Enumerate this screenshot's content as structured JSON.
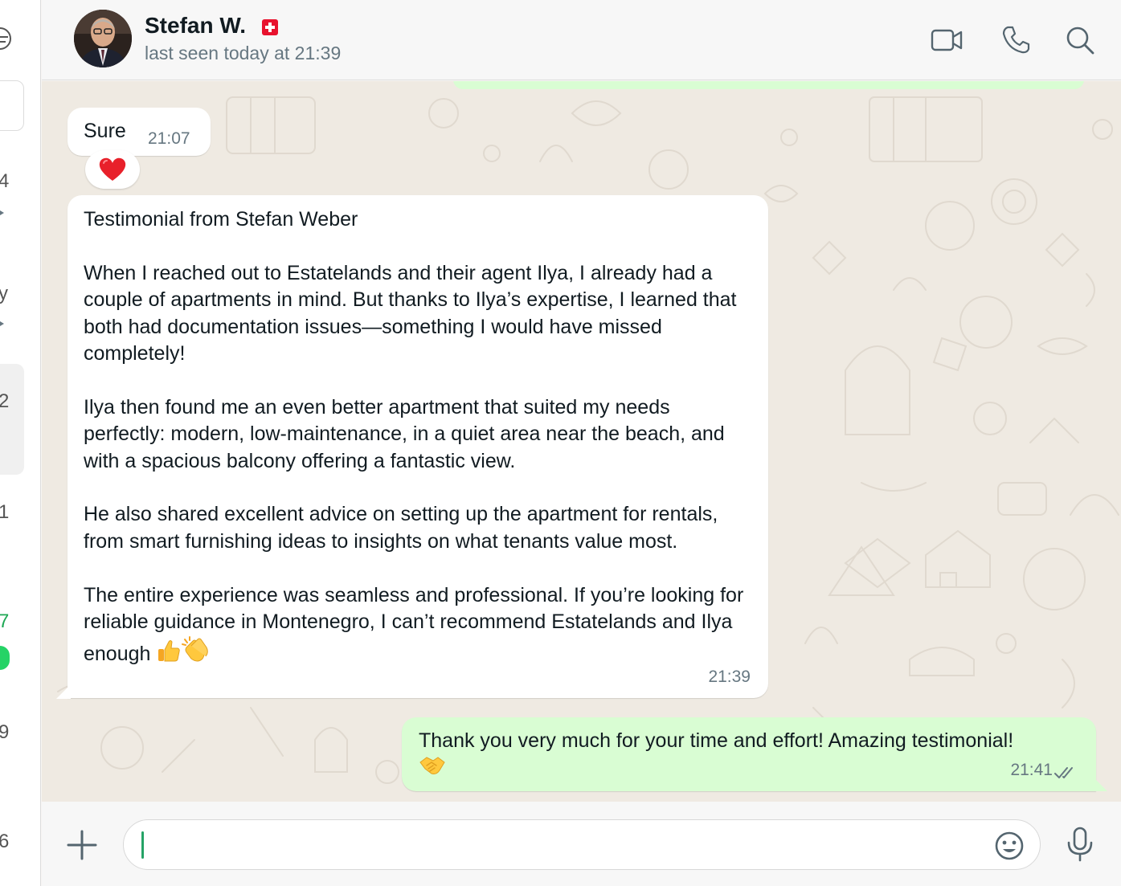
{
  "sidebar": {
    "fragments": [
      "4",
      "y",
      "2",
      "1",
      "7",
      "9",
      "6"
    ]
  },
  "header": {
    "contact_name": "Stefan W.",
    "flag": "swiss-flag",
    "status": "last seen today at 21:39",
    "icons": [
      "video-call-icon",
      "voice-call-icon",
      "search-icon"
    ]
  },
  "messages": [
    {
      "direction": "incoming",
      "text": "Sure",
      "time": "21:07",
      "reaction": "heart-emoji"
    },
    {
      "direction": "incoming",
      "text": "Testimonial from Stefan Weber\n\nWhen I reached out to Estatelands and their agent Ilya, I already had a couple of apartments in mind. But thanks to Ilya’s expertise, I learned that both had documentation issues—something I would have missed completely!\n\nIlya then found me an even better apartment that suited my needs perfectly: modern, low-maintenance, in a quiet area near the beach, and with a spacious balcony offering a fantastic view.\n\nHe also shared excellent advice on setting up the apartment for rentals, from smart furnishing ideas to insights on what tenants value most.\n\nThe entire experience was seamless and professional. If you’re looking for reliable guidance in Montenegro, I can’t recommend Estatelands and Ilya enough",
      "trailing_emojis": [
        "thumbs-up-emoji",
        "clapping-hands-emoji"
      ],
      "time": "21:39"
    },
    {
      "direction": "outgoing",
      "text": "Thank you very much for your time and effort! Amazing testimonial!",
      "trailing_emojis": [
        "handshake-emoji"
      ],
      "time": "21:41",
      "status": "read"
    }
  ],
  "composer": {
    "placeholder": "",
    "value": "",
    "icons": [
      "plus-icon",
      "emoji-icon",
      "microphone-icon"
    ]
  },
  "colors": {
    "outgoing_bubble": "#d9fdd3",
    "incoming_bubble": "#ffffff",
    "chat_background": "#efeae2",
    "read_ticks": "#667781",
    "online_badge": "#25d366"
  }
}
